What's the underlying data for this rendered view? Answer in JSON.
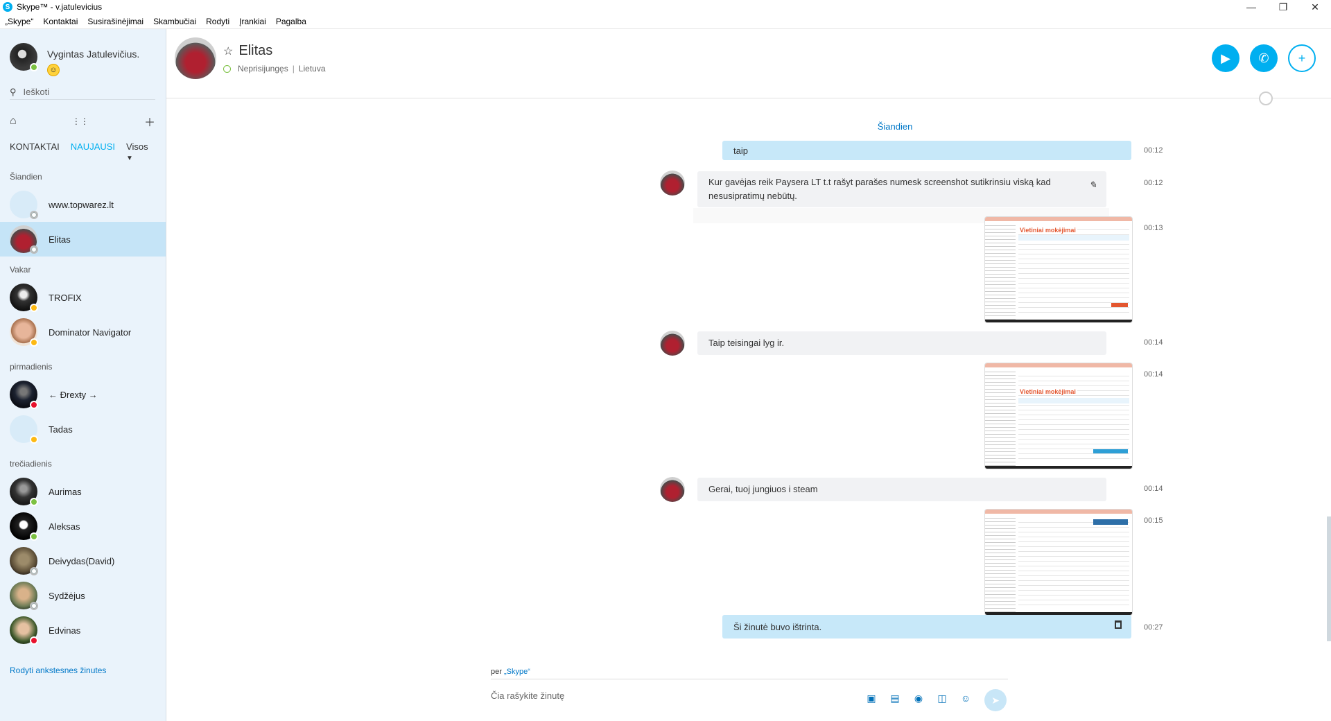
{
  "window": {
    "title": "Skype™ - v.jatulevicius"
  },
  "menu": [
    "„Skype“",
    "Kontaktai",
    "Susirašinėjimai",
    "Skambučiai",
    "Rodyti",
    "Įrankiai",
    "Pagalba"
  ],
  "profile": {
    "name": "Vygintas Jatulevičius."
  },
  "search": {
    "placeholder": "Ieškoti"
  },
  "tabs": {
    "contacts": "KONTAKTAI",
    "recent": "NAUJAUSI",
    "filter": "Visos"
  },
  "groups": {
    "today": "Šiandien",
    "yesterday": "Vakar",
    "monday": "pirmadienis",
    "wednesday": "trečiadienis"
  },
  "contacts": [
    {
      "name": "www.topwarez.lt",
      "status": "off"
    },
    {
      "name": "Elitas",
      "status": "off",
      "selected": true
    },
    {
      "name": "TROFIX",
      "status": "away"
    },
    {
      "name": "Dominator Navigator",
      "status": "away"
    },
    {
      "name": "← Ðrexŧy →",
      "status": "dnd"
    },
    {
      "name": "Tadas",
      "status": "away"
    },
    {
      "name": "Aurimas",
      "status": "on"
    },
    {
      "name": "Aleksas",
      "status": "on"
    },
    {
      "name": "Deivydas(David)",
      "status": "off"
    },
    {
      "name": "Sydžėjus",
      "status": "off"
    },
    {
      "name": "Edvinas",
      "status": "dnd"
    }
  ],
  "more_link": "Rodyti ankstesnes žinutes",
  "header": {
    "name": "Elitas",
    "status": "Neprisijungęs",
    "location": "Lietuva"
  },
  "conversation": {
    "date_divider": "Šiandien",
    "messages": [
      {
        "dir": "out",
        "text": "taip",
        "time": "00:12"
      },
      {
        "dir": "in",
        "text": "Kur gavėjas reik Paysera LT t.t rašyt parašes numesk screenshot sutikrinsiu viską kad nesusipratimų nebūtų.",
        "time": "00:12"
      },
      {
        "dir": "out",
        "image_title": "Vietiniai mokėjimai",
        "time": "00:13"
      },
      {
        "dir": "in",
        "text": "Taip teisingai lyg ir.",
        "time": "00:14"
      },
      {
        "dir": "out",
        "image_title": "Vietiniai mokėjimai",
        "time": "00:14"
      },
      {
        "dir": "in",
        "text": "Gerai, tuoj jungiuos i steam",
        "time": "00:14"
      },
      {
        "dir": "out",
        "image_title": "",
        "time": "00:15"
      },
      {
        "dir": "out",
        "text": "Ši žinutė buvo ištrinta.",
        "time": "00:27"
      }
    ]
  },
  "composer": {
    "via": "per",
    "via_service": "„Skype“",
    "placeholder": "Čia rašykite žinutę"
  }
}
